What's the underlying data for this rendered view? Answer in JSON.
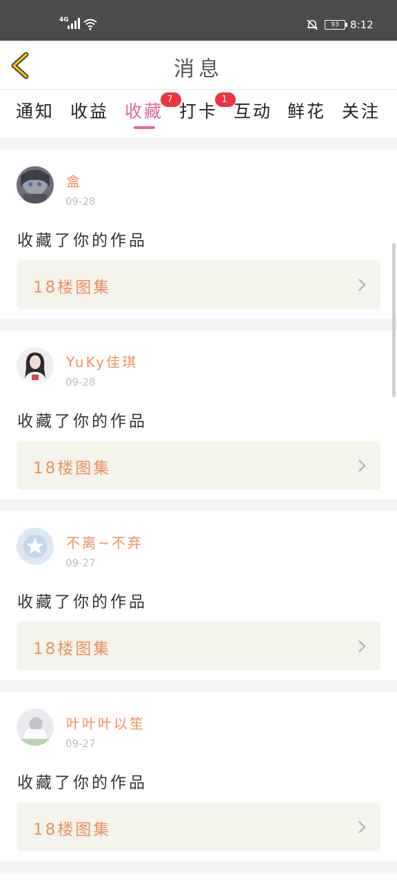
{
  "status_bar": {
    "network": "4G",
    "battery": "93",
    "time": "8:12",
    "icons": [
      "signal-icon",
      "wifi-icon",
      "bell-mute-icon",
      "battery-icon"
    ]
  },
  "header": {
    "title": "消息",
    "back_icon": "back-chevron-icon"
  },
  "tabs": [
    {
      "label": "通知",
      "active": false,
      "badge": ""
    },
    {
      "label": "收益",
      "active": false,
      "badge": ""
    },
    {
      "label": "收藏",
      "active": true,
      "badge": "7"
    },
    {
      "label": "打卡",
      "active": false,
      "badge": "1"
    },
    {
      "label": "互动",
      "active": false,
      "badge": ""
    },
    {
      "label": "鲜花",
      "active": false,
      "badge": ""
    },
    {
      "label": "关注",
      "active": false,
      "badge": ""
    }
  ],
  "items": [
    {
      "user": "盒",
      "date": "09-28",
      "message": "收藏了你的作品",
      "work": "18楼图集"
    },
    {
      "user": "YuKy佳琪",
      "date": "09-28",
      "message": "收藏了你的作品",
      "work": "18楼图集"
    },
    {
      "user": "不离~不弃",
      "date": "09-27",
      "message": "收藏了你的作品",
      "work": "18楼图集"
    },
    {
      "user": "叶叶叶以笙",
      "date": "09-27",
      "message": "收藏了你的作品",
      "work": "18楼图集"
    }
  ],
  "colors": {
    "accent_pink": "#e1669a",
    "username_orange": "#ee8f5e",
    "badge_red": "#ef3340",
    "back_yellow": "#e6b800"
  }
}
